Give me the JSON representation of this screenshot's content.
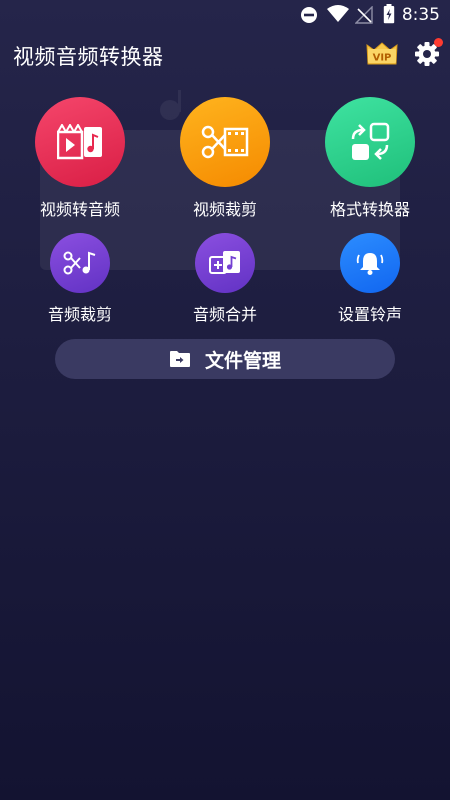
{
  "status_bar": {
    "time": "8:35",
    "icons": [
      "dnd-icon",
      "wifi-icon",
      "no-signal-icon",
      "battery-charging-icon"
    ]
  },
  "header": {
    "title": "视频音频转换器",
    "vip_label": "VIP",
    "icons": [
      "vip-crown-icon",
      "gear-icon"
    ]
  },
  "features": [
    {
      "label": "视频转音频",
      "icon": "video-to-audio-icon",
      "color": "#e8294f"
    },
    {
      "label": "视频裁剪",
      "icon": "video-cut-icon",
      "color": "#fba214"
    },
    {
      "label": "格式转换器",
      "icon": "format-convert-icon",
      "color": "#2dd08d"
    },
    {
      "label": "音频裁剪",
      "icon": "audio-cut-icon",
      "color": "#7440d2"
    },
    {
      "label": "音频合并",
      "icon": "audio-merge-icon",
      "color": "#7440d2"
    },
    {
      "label": "设置铃声",
      "icon": "ringtone-bell-icon",
      "color": "#1a76f8"
    }
  ],
  "file_manager": {
    "label": "文件管理",
    "icon": "folder-arrow-icon"
  }
}
